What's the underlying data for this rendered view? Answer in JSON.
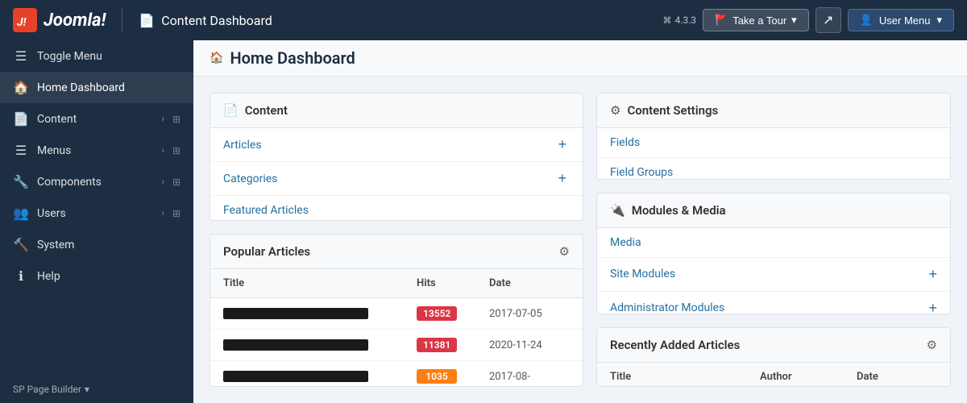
{
  "topbar": {
    "logo_text": "Joomla!",
    "page_title": "Content Dashboard",
    "page_title_icon": "📄",
    "version_icon": "⌘",
    "version": "4.3.3",
    "tour_btn_label": "Take a Tour",
    "external_icon": "↗",
    "user_menu_label": "User Menu",
    "chevron": "▾"
  },
  "sidebar": {
    "toggle_label": "Toggle Menu",
    "home_label": "Home Dashboard",
    "items": [
      {
        "label": "Content",
        "icon": "📄",
        "has_arrow": true,
        "has_grid": true
      },
      {
        "label": "Menus",
        "icon": "☰",
        "has_arrow": true,
        "has_grid": true
      },
      {
        "label": "Components",
        "icon": "🔧",
        "has_arrow": true,
        "has_grid": true
      },
      {
        "label": "Users",
        "icon": "👥",
        "has_arrow": true,
        "has_grid": true
      },
      {
        "label": "System",
        "icon": "🔨",
        "has_arrow": false,
        "has_grid": false
      },
      {
        "label": "Help",
        "icon": "ℹ",
        "has_arrow": false,
        "has_grid": false
      }
    ],
    "footer_label": "SP Page Builder",
    "footer_chevron": "▾"
  },
  "subpage_header": {
    "icon": "🏠",
    "text": "Home Dashboard"
  },
  "content_card": {
    "title": "Content",
    "icon": "📄",
    "links": [
      {
        "label": "Articles",
        "has_add": true
      },
      {
        "label": "Categories",
        "has_add": true
      },
      {
        "label": "Featured Articles",
        "has_add": false
      }
    ]
  },
  "popular_articles": {
    "title": "Popular Articles",
    "gear_icon": "⚙",
    "columns": [
      "Title",
      "Hits",
      "Date"
    ],
    "rows": [
      {
        "hits": "13552",
        "hits_color": "red",
        "date": "2017-07-05"
      },
      {
        "hits": "11381",
        "hits_color": "red",
        "date": "2020-11-24"
      },
      {
        "hits": "1035",
        "hits_color": "orange",
        "date": "2017-08-"
      }
    ]
  },
  "content_settings": {
    "title": "Content Settings",
    "icon": "⚙",
    "links": [
      {
        "label": "Fields",
        "has_add": false
      },
      {
        "label": "Field Groups",
        "has_add": false
      }
    ]
  },
  "modules_media": {
    "title": "Modules & Media",
    "icon": "🔌",
    "links": [
      {
        "label": "Media",
        "has_add": false
      },
      {
        "label": "Site Modules",
        "has_add": true
      },
      {
        "label": "Administrator Modules",
        "has_add": true
      }
    ]
  },
  "recently_added": {
    "title": "Recently Added Articles",
    "gear_icon": "⚙",
    "columns": [
      "Title",
      "Author",
      "Date"
    ]
  }
}
